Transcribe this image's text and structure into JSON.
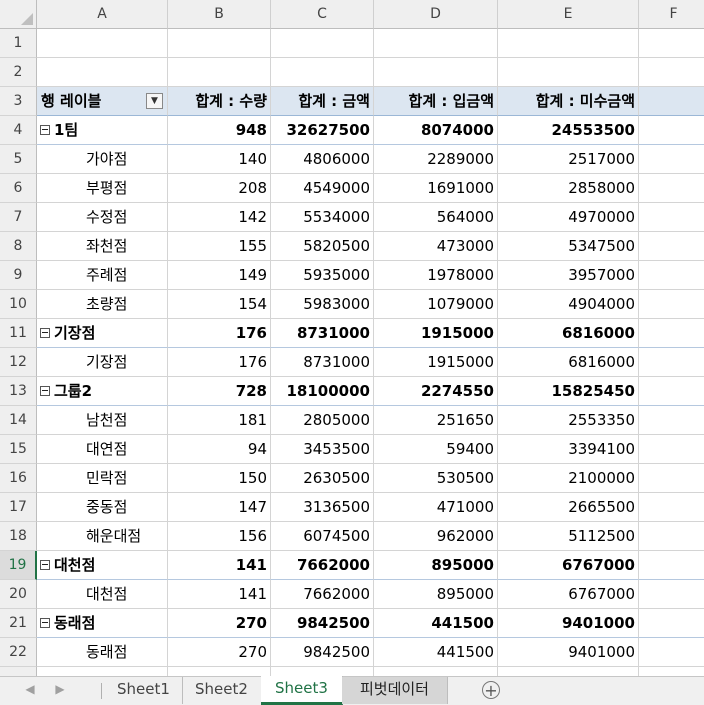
{
  "columns": [
    "A",
    "B",
    "C",
    "D",
    "E",
    "F"
  ],
  "active_column": "",
  "active_row": "19",
  "rows": [
    {
      "n": "1",
      "type": "empty",
      "cells": [
        "",
        "",
        "",
        "",
        ""
      ]
    },
    {
      "n": "2",
      "type": "empty",
      "cells": [
        "",
        "",
        "",
        "",
        ""
      ]
    },
    {
      "n": "3",
      "type": "header",
      "cells": [
        "행 레이블",
        "합계 : 수량",
        "합계 : 금액",
        "합계 : 입금액",
        "합계 : 미수금액"
      ]
    },
    {
      "n": "4",
      "type": "group",
      "cells": [
        "1팀",
        "948",
        "32627500",
        "8074000",
        "24553500"
      ]
    },
    {
      "n": "5",
      "type": "item",
      "cells": [
        "가야점",
        "140",
        "4806000",
        "2289000",
        "2517000"
      ]
    },
    {
      "n": "6",
      "type": "item",
      "cells": [
        "부평점",
        "208",
        "4549000",
        "1691000",
        "2858000"
      ]
    },
    {
      "n": "7",
      "type": "item",
      "cells": [
        "수정점",
        "142",
        "5534000",
        "564000",
        "4970000"
      ]
    },
    {
      "n": "8",
      "type": "item",
      "cells": [
        "좌천점",
        "155",
        "5820500",
        "473000",
        "5347500"
      ]
    },
    {
      "n": "9",
      "type": "item",
      "cells": [
        "주례점",
        "149",
        "5935000",
        "1978000",
        "3957000"
      ]
    },
    {
      "n": "10",
      "type": "item",
      "cells": [
        "초량점",
        "154",
        "5983000",
        "1079000",
        "4904000"
      ]
    },
    {
      "n": "11",
      "type": "group",
      "cells": [
        "기장점",
        "176",
        "8731000",
        "1915000",
        "6816000"
      ]
    },
    {
      "n": "12",
      "type": "item",
      "cells": [
        "기장점",
        "176",
        "8731000",
        "1915000",
        "6816000"
      ]
    },
    {
      "n": "13",
      "type": "group",
      "cells": [
        "그룹2",
        "728",
        "18100000",
        "2274550",
        "15825450"
      ]
    },
    {
      "n": "14",
      "type": "item",
      "cells": [
        "남천점",
        "181",
        "2805000",
        "251650",
        "2553350"
      ]
    },
    {
      "n": "15",
      "type": "item",
      "cells": [
        "대연점",
        "94",
        "3453500",
        "59400",
        "3394100"
      ]
    },
    {
      "n": "16",
      "type": "item",
      "cells": [
        "민락점",
        "150",
        "2630500",
        "530500",
        "2100000"
      ]
    },
    {
      "n": "17",
      "type": "item",
      "cells": [
        "중동점",
        "147",
        "3136500",
        "471000",
        "2665500"
      ]
    },
    {
      "n": "18",
      "type": "item",
      "cells": [
        "해운대점",
        "156",
        "6074500",
        "962000",
        "5112500"
      ]
    },
    {
      "n": "19",
      "type": "group",
      "cells": [
        "대천점",
        "141",
        "7662000",
        "895000",
        "6767000"
      ]
    },
    {
      "n": "20",
      "type": "item",
      "cells": [
        "대천점",
        "141",
        "7662000",
        "895000",
        "6767000"
      ]
    },
    {
      "n": "21",
      "type": "group",
      "cells": [
        "동래점",
        "270",
        "9842500",
        "441500",
        "9401000"
      ]
    },
    {
      "n": "22",
      "type": "item",
      "cells": [
        "동래점",
        "270",
        "9842500",
        "441500",
        "9401000"
      ]
    }
  ],
  "sheet_tabs": [
    {
      "label": "Sheet1",
      "state": "normal"
    },
    {
      "label": "Sheet2",
      "state": "normal"
    },
    {
      "label": "Sheet3",
      "state": "active"
    },
    {
      "label": "피벗데이터",
      "state": "pivot"
    }
  ],
  "icons": {
    "add_sheet": "plus-circle-icon",
    "prev": "triangle-left-icon",
    "next": "triangle-right-icon",
    "filter": "dropdown-arrow-icon",
    "collapse": "minus-box-icon"
  },
  "colors": {
    "accent": "#217346",
    "pivot_header": "#dce6f1",
    "tab_gray": "#d6d6d6"
  }
}
